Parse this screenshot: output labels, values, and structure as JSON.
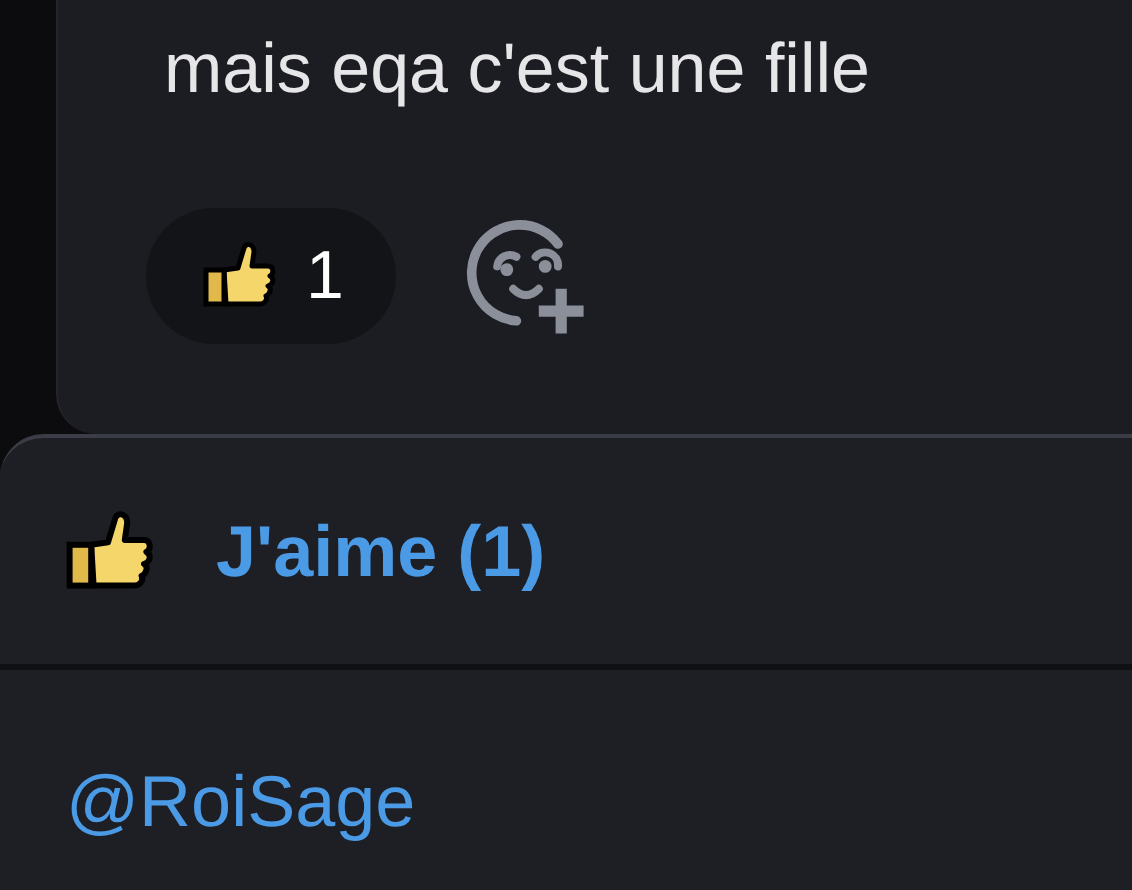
{
  "message": {
    "text": "mais eqa c'est une fille",
    "reactions": [
      {
        "kind": "thumbs-up",
        "count": "1"
      }
    ]
  },
  "sheet": {
    "kind": "thumbs-up",
    "title": "J'aime (1)",
    "users": [
      "@RoiSage"
    ]
  }
}
